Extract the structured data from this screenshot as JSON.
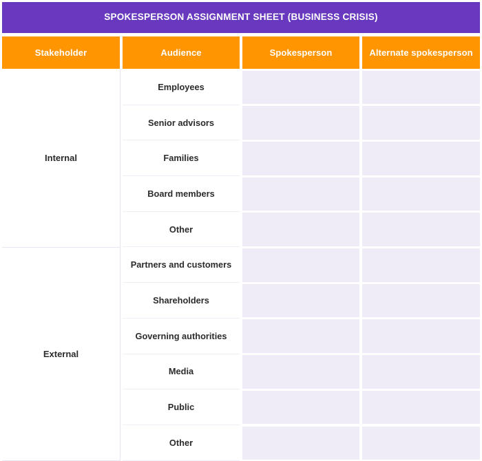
{
  "document": {
    "title": "SPOKESPERSON ASSIGNMENT SHEET (BUSINESS CRISIS)"
  },
  "colors": {
    "title_band": "#6838BE",
    "header_row": "#FF9500",
    "fillable_cell": "#EFECF7",
    "cell_background": "#FFFFFF",
    "text": "#2B2B2B",
    "header_text": "#FFFFFF"
  },
  "table": {
    "columns": [
      {
        "key": "stakeholder",
        "label": "Stakeholder"
      },
      {
        "key": "audience",
        "label": "Audience"
      },
      {
        "key": "spokesperson",
        "label": "Spokesperson"
      },
      {
        "key": "alternate_spokesperson",
        "label": "Alternate spokesperson"
      }
    ],
    "groups": [
      {
        "stakeholder": "Internal",
        "rows": [
          {
            "audience": "Employees",
            "spokesperson": "",
            "alternate_spokesperson": ""
          },
          {
            "audience": "Senior advisors",
            "spokesperson": "",
            "alternate_spokesperson": ""
          },
          {
            "audience": "Families",
            "spokesperson": "",
            "alternate_spokesperson": ""
          },
          {
            "audience": "Board members",
            "spokesperson": "",
            "alternate_spokesperson": ""
          },
          {
            "audience": "Other",
            "spokesperson": "",
            "alternate_spokesperson": ""
          }
        ]
      },
      {
        "stakeholder": "External",
        "rows": [
          {
            "audience": "Partners and customers",
            "spokesperson": "",
            "alternate_spokesperson": ""
          },
          {
            "audience": "Shareholders",
            "spokesperson": "",
            "alternate_spokesperson": ""
          },
          {
            "audience": "Governing authorities",
            "spokesperson": "",
            "alternate_spokesperson": ""
          },
          {
            "audience": "Media",
            "spokesperson": "",
            "alternate_spokesperson": ""
          },
          {
            "audience": "Public",
            "spokesperson": "",
            "alternate_spokesperson": ""
          },
          {
            "audience": "Other",
            "spokesperson": "",
            "alternate_spokesperson": ""
          }
        ]
      }
    ]
  }
}
